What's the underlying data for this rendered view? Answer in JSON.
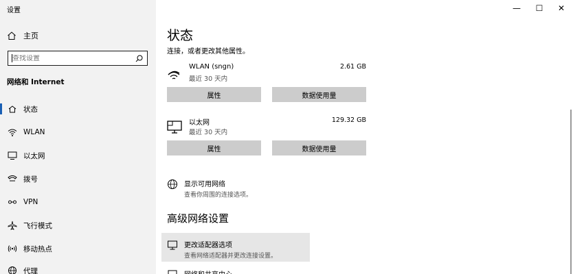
{
  "window": {
    "title": "设置",
    "controls": {
      "minimize": "—",
      "maximize": "☐",
      "close": "✕"
    }
  },
  "sidebar": {
    "home_label": "主页",
    "search_placeholder": "查找设置",
    "section_title": "网络和 Internet",
    "items": [
      {
        "label": "状态",
        "icon": "home-status-icon"
      },
      {
        "label": "WLAN",
        "icon": "wifi-icon"
      },
      {
        "label": "以太网",
        "icon": "ethernet-icon"
      },
      {
        "label": "拨号",
        "icon": "dialup-icon"
      },
      {
        "label": "VPN",
        "icon": "vpn-icon"
      },
      {
        "label": "飞行模式",
        "icon": "airplane-icon"
      },
      {
        "label": "移动热点",
        "icon": "hotspot-icon"
      },
      {
        "label": "代理",
        "icon": "globe-icon"
      }
    ]
  },
  "main": {
    "title": "状态",
    "subtitle": "连接，或者更改其他属性。",
    "networks": [
      {
        "name": "WLAN (sngn)",
        "status": "最近 30 天内",
        "usage": "2.61 GB",
        "btn_props": "属性",
        "btn_usage": "数据使用量"
      },
      {
        "name": "以太网",
        "status": "最近 30 天内",
        "usage": "129.32 GB",
        "btn_props": "属性",
        "btn_usage": "数据使用量"
      }
    ],
    "show_available": "显示可用网络",
    "show_available_desc": "查看你周围的连接选项。",
    "advanced_heading": "高级网络设置",
    "adapter_title": "更改适配器选项",
    "adapter_desc": "查看网络适配器并更改连接设置。",
    "sharing_title": "网络和共享中心"
  },
  "colors": {
    "sidebar_bg": "#f2f2f2",
    "button_bg": "#cccccc",
    "accent": "#1a5fb4"
  }
}
